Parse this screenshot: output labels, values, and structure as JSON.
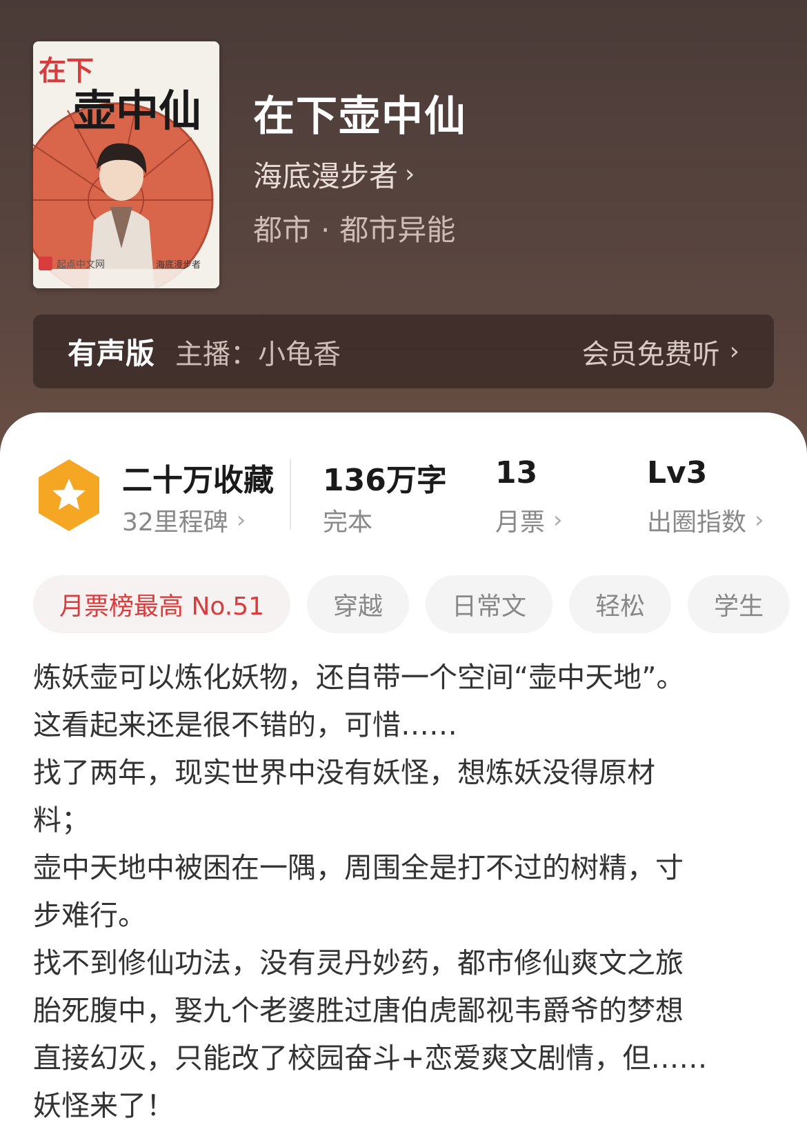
{
  "book": {
    "title": "在下壶中仙",
    "author": "海底漫步者",
    "category": "都市",
    "subcategory": "都市异能",
    "cover": {
      "top_text": "在下",
      "main_text": "壶中仙",
      "publisher": "起点中文网",
      "author_stamp": "海底漫步者"
    }
  },
  "audio": {
    "tag": "有声版",
    "host": "主播：小龟香",
    "link": "会员免费听"
  },
  "stats": {
    "favorites": "二十万收藏",
    "milestones": "32里程碑",
    "words": "136万字",
    "status": "完本",
    "monthly_votes": "13",
    "monthly_votes_label": "月票",
    "level": "Lv3",
    "level_label": "出圈指数"
  },
  "tags": [
    "月票榜最高 No.51",
    "穿越",
    "日常文",
    "轻松",
    "学生"
  ],
  "description": [
    "炼妖壶可以炼化妖物，还自带一个空间“壶中天地”。",
    "这看起来还是很不错的，可惜……",
    "找了两年，现实世界中没有妖怪，想炼妖没得原材",
    "料；",
    "壶中天地中被困在一隅，周围全是打不过的树精，寸",
    "步难行。",
    "找不到修仙功法，没有灵丹妙药，都市修仙爽文之旅",
    "胎死腹中，娶九个老婆胜过唐伯虎鄙视韦爵爷的梦想",
    "直接幻灭，只能改了校园奋斗+恋爱爽文剧情，但……",
    "妖怪来了！"
  ],
  "colors": {
    "accent_red": "#d83c3c",
    "badge_orange": "#f5a623"
  }
}
